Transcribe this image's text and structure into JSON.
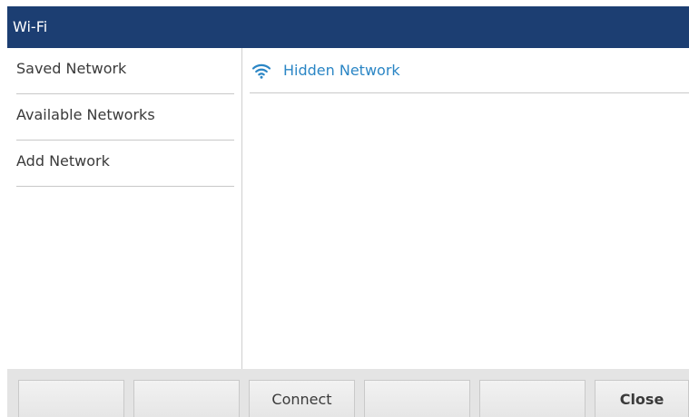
{
  "title": "Wi-Fi",
  "sidebar": {
    "items": [
      {
        "label": "Saved Network"
      },
      {
        "label": "Available Networks"
      },
      {
        "label": "Add Network"
      }
    ]
  },
  "main": {
    "networks": [
      {
        "name": "Hidden Network",
        "icon": "wifi-icon"
      }
    ]
  },
  "softkeys": [
    {
      "label": ""
    },
    {
      "label": ""
    },
    {
      "label": "Connect"
    },
    {
      "label": ""
    },
    {
      "label": ""
    },
    {
      "label": "Close"
    }
  ],
  "colors": {
    "titlebar": "#1c3e72",
    "accent": "#2b86c5"
  }
}
